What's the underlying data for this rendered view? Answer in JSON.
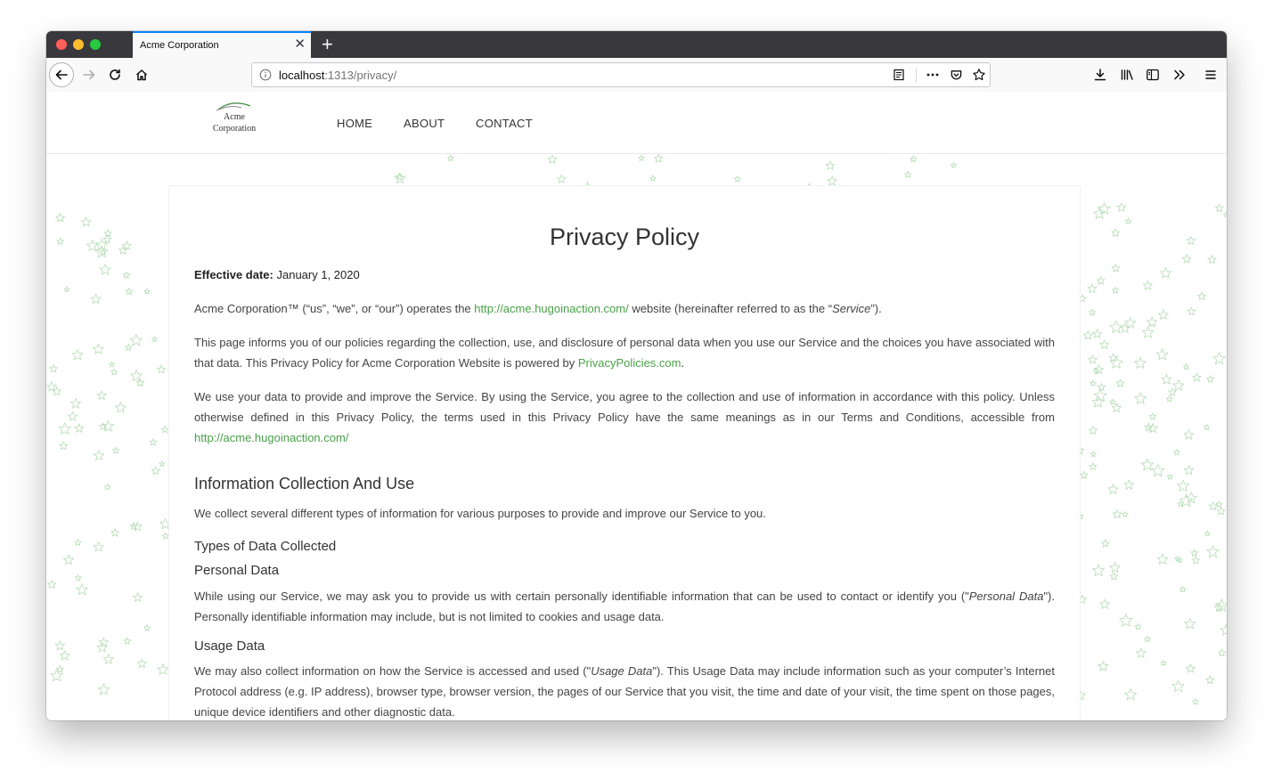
{
  "browser": {
    "tab_title": "Acme Corporation",
    "tab_close": "✕",
    "new_tab": "+",
    "url_host": "localhost",
    "url_rest": ":1313/privacy/"
  },
  "site": {
    "logo_line1": "Acme",
    "logo_line2": "Corporation",
    "nav": [
      "HOME",
      "ABOUT",
      "CONTACT"
    ]
  },
  "article": {
    "title": "Privacy Policy",
    "effective_label": "Effective date:",
    "effective_value": " January 1, 2020",
    "p1_a": "Acme Corporation™ (“us”, “we”, or “our”) operates the ",
    "p1_link": "http://acme.hugoinaction.com/",
    "p1_b": " website (hereinafter referred to as the “",
    "p1_em": "Service",
    "p1_c": "”).",
    "p2_a": "This page informs you of our policies regarding the collection, use, and disclosure of personal data when you use our Service and the choices you have associated with that data. This Privacy Policy for Acme Corporation Website is powered by ",
    "p2_link": "PrivacyPolicies.com",
    "p2_b": ".",
    "p3_a": "We use your data to provide and improve the Service. By using the Service, you agree to the collection and use of information in accordance with this policy. Unless otherwise defined in this Privacy Policy, the terms used in this Privacy Policy have the same meanings as in our Terms and Conditions, accessible from ",
    "p3_link": "http://acme.hugoinaction.com/",
    "h2_collection": "Information Collection And Use",
    "p4": "We collect several different types of information for various purposes to provide and improve our Service to you.",
    "h3_types": "Types of Data Collected",
    "h3_personal": "Personal Data",
    "p5_a": "While using our Service, we may ask you to provide us with certain personally identifiable information that can be used to contact or identify you (\"",
    "p5_em": "Personal Data",
    "p5_b": "\"). Personally identifiable information may include, but is not limited to cookies and usage data.",
    "h3_usage": "Usage Data",
    "p6_a": "We may also collect information on how the Service is accessed and used (\"",
    "p6_em": "Usage Data",
    "p6_b": "\"). This Usage Data may include information such as your computer’s Internet Protocol address (e.g. IP address), browser type, browser version, the pages of our Service that you visit, the time and date of your visit, the time spent on those pages, unique device identifiers and other diagnostic data."
  },
  "colors": {
    "link": "#4aa04a",
    "tab_accent": "#0a84ff",
    "titlebar": "#38383d"
  }
}
